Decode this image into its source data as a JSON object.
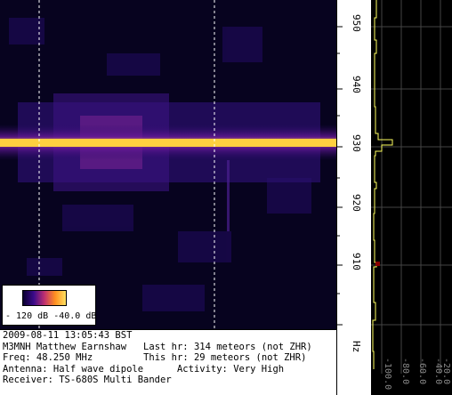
{
  "legend": {
    "min_label": "- 120 dB",
    "max_label": "-40.0 dB"
  },
  "info": {
    "timestamp": "2009-08-11 13:05:43 BST",
    "operator": "M3MNH Matthew Earnshaw",
    "last_hr": "Last hr: 314 meteors (not ZHR)",
    "freq": "Freq: 48.250 MHz",
    "this_hr": "This hr: 29 meteors (not ZHR)",
    "antenna": "Antenna: Half wave dipole",
    "activity": "Activity: Very High",
    "receiver": "Receiver: TS-680S Multi Bander"
  },
  "freq_axis": {
    "ticks": [
      "950",
      "940",
      "930",
      "920",
      "910"
    ],
    "unit": "Hz"
  },
  "activity_axis": {
    "ticks": [
      "-100.0",
      "-80.0",
      "-60.0",
      "-40.0",
      "-20.0"
    ]
  },
  "colors": {
    "band": "#ffd040",
    "trace": "#ffff60",
    "marker": "#8b0000",
    "grid": "#444444"
  }
}
